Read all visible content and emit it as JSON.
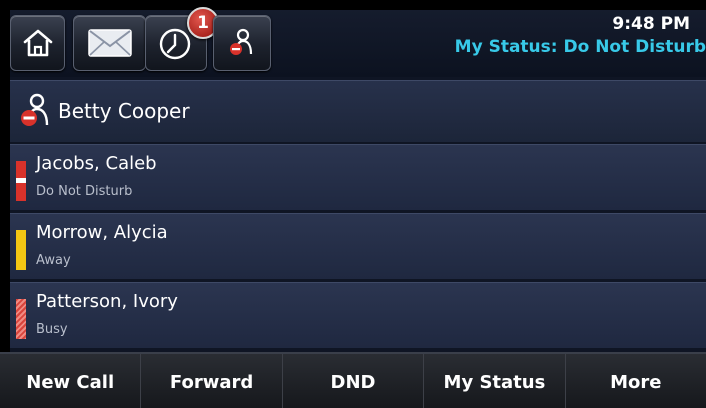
{
  "topbar": {
    "icons": [
      "home-icon",
      "mail-icon",
      "recent-calls-icon",
      "presence-dnd-icon"
    ],
    "missed_calls_badge": "1",
    "time": "9:48 PM",
    "my_status": "My Status: Do Not Disturb"
  },
  "header": {
    "name": "Betty Cooper",
    "icon": "presence-dnd-icon"
  },
  "contacts": [
    {
      "name": "Jacobs, Caleb",
      "status": "Do Not Disturb",
      "presence_color": "#d8322b"
    },
    {
      "name": "Morrow, Alycia",
      "status": "Away",
      "presence_color": "#f3c613"
    },
    {
      "name": "Patterson, Ivory",
      "status": "Busy",
      "presence_color": "#d9443c"
    }
  ],
  "softkeys": [
    "New Call",
    "Forward",
    "DND",
    "My Status",
    "More"
  ],
  "colors": {
    "accent": "#38c9e8",
    "badge": "#c0312a"
  }
}
